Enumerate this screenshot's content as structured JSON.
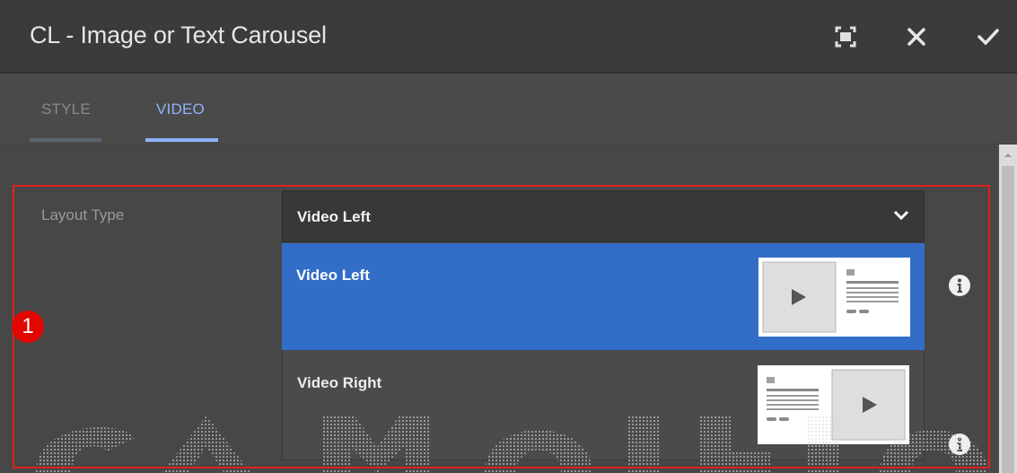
{
  "dialog": {
    "title": "CL - Image or Text Carousel",
    "icons": {
      "fullscreen": "fullscreen-icon",
      "close": "close-icon",
      "done": "checkmark-icon"
    }
  },
  "tabs": [
    {
      "label": "STYLE",
      "active": false
    },
    {
      "label": "VIDEO",
      "active": true
    }
  ],
  "layout_field": {
    "label": "Layout Type",
    "selected": "Video Left",
    "options": [
      {
        "label": "Video Left",
        "selected": true,
        "thumbnail": "video-left-layout-thumbnail"
      },
      {
        "label": "Video Right",
        "selected": false,
        "thumbnail": "video-right-layout-thumbnail"
      }
    ]
  },
  "annotation": {
    "number": "1"
  },
  "colors": {
    "header_bg": "#3b3b3b",
    "panel_bg": "#4a4a4a",
    "accent": "#326ec8",
    "tab_active": "#8fb3ff",
    "highlight_border": "#e0201c",
    "badge": "#e10600"
  }
}
